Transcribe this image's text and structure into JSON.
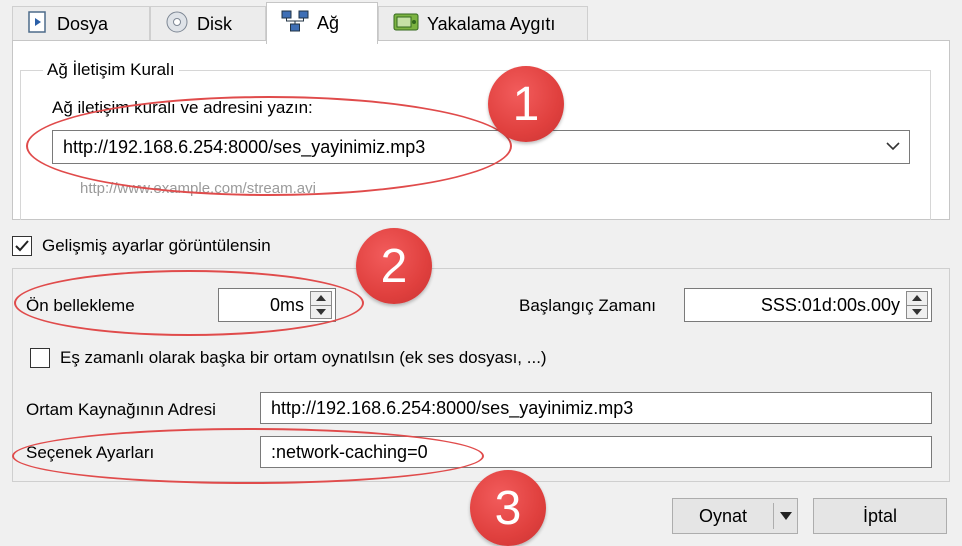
{
  "tabs": [
    {
      "label": "Dosya",
      "icon": "file-icon"
    },
    {
      "label": "Disk",
      "icon": "disc-icon"
    },
    {
      "label": "Ağ",
      "icon": "network-icon"
    },
    {
      "label": "Yakalama Aygıtı",
      "icon": "capture-device-icon"
    }
  ],
  "network": {
    "group_title": "Ağ İletişim Kuralı",
    "prompt": "Ağ iletişim kuralı ve adresini yazın:",
    "url_value": "http://192.168.6.254:8000/ses_yayinimiz.mp3",
    "example_hint": "http://www.example.com/stream.avi"
  },
  "advanced": {
    "show_label": "Gelişmiş ayarlar görüntülensin",
    "show_checked": true,
    "caching_label": "Ön bellekleme",
    "caching_value": "0ms",
    "start_time_label": "Başlangıç Zamanı",
    "start_time_value": "SSS:01d:00s.00y",
    "sync_label": "Eş zamanlı olarak başka bir ortam oynatılsın (ek ses dosyası, ...)",
    "sync_checked": false,
    "mrl_label": "Ortam Kaynağının Adresi",
    "mrl_value": "http://192.168.6.254:8000/ses_yayinimiz.mp3",
    "options_label": "Seçenek Ayarları",
    "options_value": ":network-caching=0"
  },
  "buttons": {
    "play": "Oynat",
    "cancel": "İptal"
  },
  "annotations": {
    "step1": "1",
    "step2": "2",
    "step3": "3",
    "color": "#e04b4b"
  }
}
